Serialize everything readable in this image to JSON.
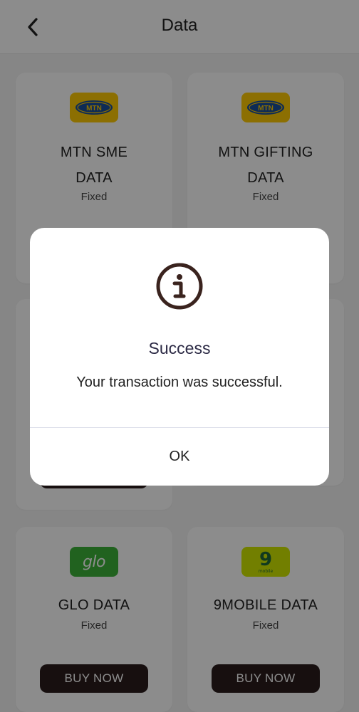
{
  "header": {
    "title": "Data",
    "back_icon": "chevron-left-icon"
  },
  "plans": [
    {
      "name_line1": "MTN SME",
      "name_line2": "DATA",
      "subtitle": "Fixed",
      "logo_text": "MTN",
      "logo_bg": "#ffcb05",
      "button": ""
    },
    {
      "name_line1": "MTN GIFTING",
      "name_line2": "DATA",
      "subtitle": "Fixed",
      "logo_text": "MTN",
      "logo_bg": "#ffcb05",
      "button": ""
    },
    {
      "name_line1": "GLO DATA",
      "name_line2": "",
      "subtitle": "Fixed",
      "logo_text": "glo",
      "logo_bg": "#3db33a",
      "button": "BUY NOW"
    },
    {
      "name_line1": "9MOBILE DATA",
      "name_line2": "",
      "subtitle": "Fixed",
      "logo_text": "9",
      "logo_sub": "mobile",
      "logo_bg": "#cfe800",
      "button": "BUY NOW"
    }
  ],
  "dialog": {
    "icon": "info-circle-icon",
    "title": "Success",
    "message": "Your transaction was successful.",
    "ok_label": "OK"
  },
  "colors": {
    "button_bg": "#2b1d1d",
    "dialog_title": "#2c2a45",
    "icon": "#3a231e"
  }
}
